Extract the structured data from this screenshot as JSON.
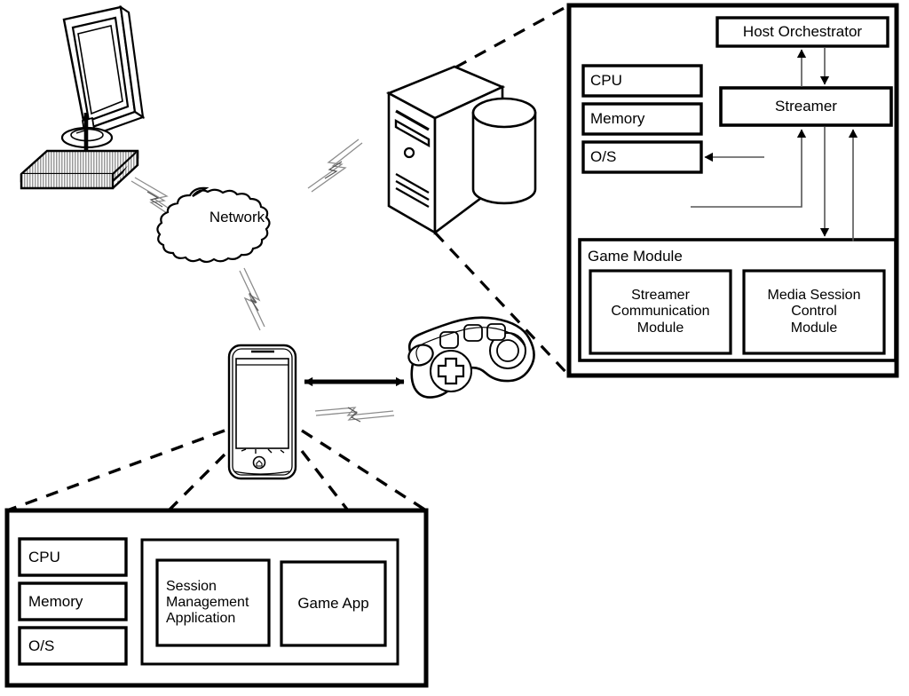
{
  "figure": {
    "kind": "patent-architecture-diagram",
    "title": "Cloud gaming system architecture",
    "style": {
      "line_color": "#000000",
      "background": "#ffffff",
      "fill": "#ffffff"
    }
  },
  "devices": {
    "monitor": {
      "name": "display-monitor",
      "label": ""
    },
    "set_top_box": {
      "name": "set-top-box",
      "label": ""
    },
    "network_cloud": {
      "name": "network-cloud",
      "label": "Network"
    },
    "server_tower": {
      "name": "server-computer",
      "label": ""
    },
    "smartphone": {
      "name": "smartphone",
      "label": ""
    },
    "gamepad": {
      "name": "game-controller",
      "label": ""
    }
  },
  "server_detail": {
    "title": "Server detail callout",
    "hardware": [
      {
        "id": "cpu",
        "label": "CPU"
      },
      {
        "id": "memory",
        "label": "Memory"
      },
      {
        "id": "os",
        "label": "O/S"
      }
    ],
    "host_orchestrator": {
      "label": "Host Orchestrator"
    },
    "streamer": {
      "label": "Streamer"
    },
    "game_module": {
      "label": "Game Module",
      "children": [
        {
          "id": "streamer-communication-module",
          "label": "Streamer\nCommunication\nModule"
        },
        {
          "id": "media-session-control-module",
          "label": "Media Session\nControl\nModule"
        }
      ]
    }
  },
  "client_detail": {
    "title": "Client device detail callout",
    "hardware": [
      {
        "id": "cpu",
        "label": "CPU"
      },
      {
        "id": "memory",
        "label": "Memory"
      },
      {
        "id": "os",
        "label": "O/S"
      }
    ],
    "applications": [
      {
        "id": "session-management-application",
        "label": "Session\nManagement\nApplication"
      },
      {
        "id": "game-app",
        "label": "Game App"
      }
    ]
  },
  "connections": [
    {
      "id": "stb-to-monitor",
      "type": "solid-arrow",
      "from": "set-top-box",
      "to": "display-monitor"
    },
    {
      "id": "stb-to-network",
      "type": "wireless-bolt",
      "from": "set-top-box",
      "to": "network-cloud"
    },
    {
      "id": "network-to-server",
      "type": "wireless-bolt",
      "from": "network-cloud",
      "to": "server-computer"
    },
    {
      "id": "network-to-phone",
      "type": "wireless-bolt",
      "from": "network-cloud",
      "to": "smartphone"
    },
    {
      "id": "phone-to-gamepad",
      "type": "double-arrow",
      "from": "smartphone",
      "to": "game-controller"
    },
    {
      "id": "phone-gamepad-wireless",
      "type": "wireless-bolt",
      "from": "smartphone",
      "to": "game-controller"
    },
    {
      "id": "server-callout",
      "type": "dashed-callout",
      "from": "server-computer",
      "to": "server-detail"
    },
    {
      "id": "phone-callout",
      "type": "dashed-callout",
      "from": "smartphone",
      "to": "client-detail"
    },
    {
      "id": "streamer-to-host",
      "type": "arrow-up",
      "from": "streamer",
      "to": "host_orchestrator"
    },
    {
      "id": "host-to-streamer",
      "type": "arrow-down",
      "from": "host_orchestrator",
      "to": "streamer"
    },
    {
      "id": "gamemodule-to-streamer",
      "type": "arrow-up",
      "from": "game_module",
      "to": "streamer"
    },
    {
      "id": "streamer-to-gamemodule",
      "type": "arrow-down",
      "from": "streamer",
      "to": "game_module"
    },
    {
      "id": "gamemodule-to-os",
      "type": "arrow-left",
      "from": "game_module",
      "to": "os"
    },
    {
      "id": "scm-to-streamer",
      "type": "arrow-up",
      "from": "streamer-communication-module",
      "to": "streamer"
    }
  ]
}
